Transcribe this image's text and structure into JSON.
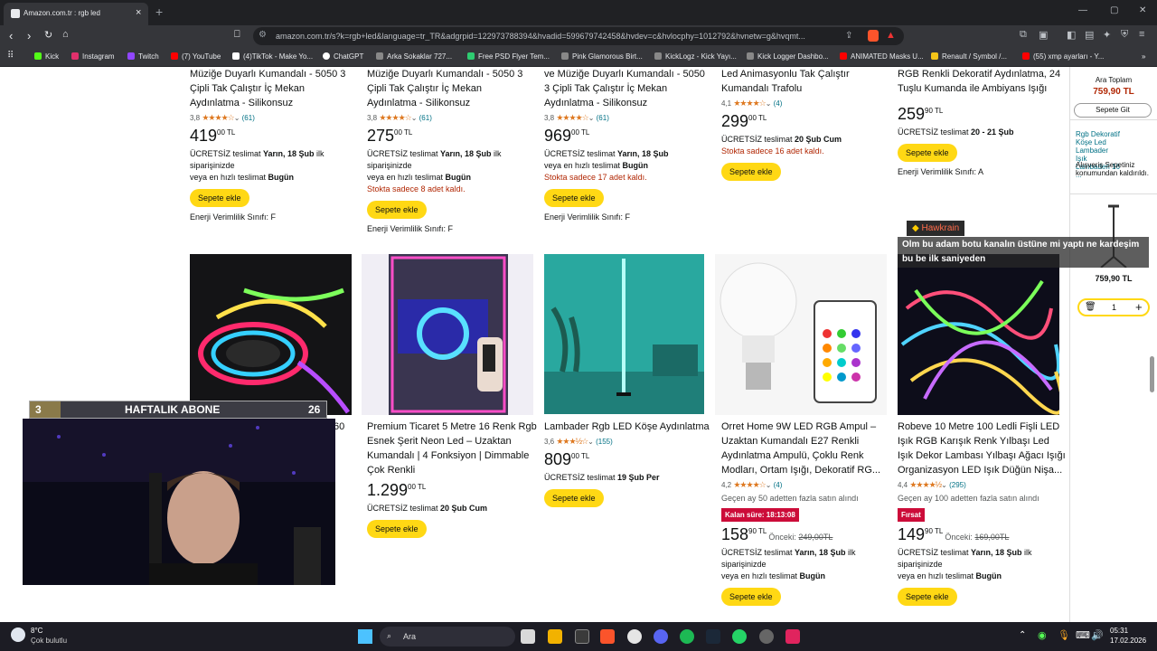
{
  "browser": {
    "tab_title": "Amazon.com.tr : rgb led",
    "new_tab": "+",
    "url": "amazon.com.tr/s?k=rgb+led&language=tr_TR&adgrpid=122973788394&hvadid=599679742458&hvdev=c&hvlocphy=1012792&hvnetw=g&hvqmt...",
    "bookmarks": [
      {
        "label": "Kick",
        "color": "#53fc18"
      },
      {
        "label": "Instagram",
        "color": "#e1306c"
      },
      {
        "label": "Twitch",
        "color": "#9146ff"
      },
      {
        "label": "(7) YouTube",
        "color": "#ff0000"
      },
      {
        "label": "(4)TikTok - Make Yo...",
        "color": "#ffffff"
      },
      {
        "label": "ChatGPT",
        "color": "#ffffff"
      },
      {
        "label": "Arka Sokaklar 727...",
        "color": "#888888"
      },
      {
        "label": "Free PSD Flyer Tem...",
        "color": "#2ecc71"
      },
      {
        "label": "Pink Glamorous Birt...",
        "color": "#888888"
      },
      {
        "label": "KickLogz - Kick Yayı...",
        "color": "#888888"
      },
      {
        "label": "Kick Logger Dashbo...",
        "color": "#888888"
      },
      {
        "label": "ANIMATED Masks U...",
        "color": "#ff0000"
      },
      {
        "label": "Renault / Symbol /...",
        "color": "#f5c518"
      },
      {
        "label": "(55) xmp ayarları - Y...",
        "color": "#ff0000"
      }
    ]
  },
  "top_cards": [
    {
      "title_l1": "Müziğe Duyarlı Kumandalı - 5050 3",
      "title_l2": "Çipli Tak Çalıştır İç Mekan",
      "title_l3": "Aydınlatma - Silikonsuz",
      "rating": "3,8",
      "stars": "★★★★☆",
      "count": "(61)",
      "price_whole": "419",
      "price_frac": "00 TL",
      "deliv_l1": "ÜCRETSİZ teslimat ",
      "deliv_b1": "Yarın, 18 Şub",
      "deliv_l1b": " ilk",
      "deliv_l2": "siparişinizde",
      "deliv_l3": "veya en hızlı teslimat ",
      "deliv_b3": "Bugün",
      "stock": "",
      "button": "Sepete ekle",
      "energy": "Enerji Verimlilik Sınıfı: F"
    },
    {
      "title_l1": "Müziğe Duyarlı Kumandalı - 5050 3",
      "title_l2": "Çipli Tak Çalıştır İç Mekan",
      "title_l3": "Aydınlatma - Silikonsuz",
      "rating": "3,8",
      "stars": "★★★★☆",
      "count": "(61)",
      "price_whole": "275",
      "price_frac": "00 TL",
      "deliv_l1": "ÜCRETSİZ teslimat ",
      "deliv_b1": "Yarın, 18 Şub",
      "deliv_l1b": " ilk",
      "deliv_l2": "siparişinizde",
      "deliv_l3": "veya en hızlı teslimat ",
      "deliv_b3": "Bugün",
      "stock": "Stokta sadece 8 adet kaldı.",
      "button": "Sepete ekle",
      "energy": "Enerji Verimlilik Sınıfı: F"
    },
    {
      "title_l1": "ve Müziğe Duyarlı Kumandalı - 5050",
      "title_l2": "3 Çipli Tak Çalıştır İç Mekan",
      "title_l3": "Aydınlatma - Silikonsuz",
      "rating": "3,8",
      "stars": "★★★★☆",
      "count": "(61)",
      "price_whole": "969",
      "price_frac": "00 TL",
      "deliv_l1": "ÜCRETSİZ teslimat ",
      "deliv_b1": "Yarın, 18 Şub",
      "deliv_l1b": "",
      "deliv_l2": "",
      "deliv_l3": "veya en hızlı teslimat ",
      "deliv_b3": "Bugün",
      "stock": "Stokta sadece 17 adet kaldı.",
      "button": "Sepete ekle",
      "energy": "Enerji Verimlilik Sınıfı: F"
    },
    {
      "title_l1": "Led Animasyonlu Tak Çalıştır",
      "title_l2": "Kumandalı Trafolu",
      "title_l3": "",
      "rating": "4,1",
      "stars": "★★★★☆",
      "count": "(4)",
      "price_whole": "299",
      "price_frac": "00 TL",
      "deliv_l1": "ÜCRETSİZ teslimat ",
      "deliv_b1": "20 Şub Cum",
      "deliv_l1b": "",
      "deliv_l2": "",
      "deliv_l3": "",
      "deliv_b3": "",
      "stock": "Stokta sadece 16 adet kaldı.",
      "button": "Sepete ekle",
      "energy": ""
    },
    {
      "title_l1": "RGB Renkli Dekoratif Aydınlatma, 24",
      "title_l2": "Tuşlu Kumanda ile Ambiyans Işığı",
      "title_l3": "",
      "rating": "",
      "stars": "",
      "count": "",
      "price_whole": "259",
      "price_frac": "90 TL",
      "deliv_l1": "ÜCRETSİZ teslimat ",
      "deliv_b1": "20 - 21 Şub",
      "deliv_l1b": "",
      "deliv_l2": "",
      "deliv_l3": "",
      "deliv_b3": "",
      "stock": "",
      "button": "Sepete ekle",
      "energy": "Enerji Verimlilik Sınıfı: A"
    }
  ],
  "bottom_cards": [
    {
      "title": "Premium Ticaret 5 Metre 16 Renk Rgb Esnek Şerit Neon Led – Uzaktan Kumandalı | 4 Fonksiyon | Dimmable Çok Renkli",
      "rating": "",
      "stars": "",
      "count": "",
      "price_whole": "1.299",
      "price_frac": "00 TL",
      "deliv": "ÜCRETSİZ teslimat ",
      "deliv_b": "20 Şub Cum",
      "button": "Sepete ekle"
    },
    {
      "title": "Lambader Rgb LED Köşe Aydınlatma",
      "rating": "3,6",
      "stars": "★★★½☆",
      "count": "(155)",
      "price_whole": "809",
      "price_frac": "00 TL",
      "deliv": "ÜCRETSİZ teslimat ",
      "deliv_b": "19 Şub Per",
      "button": "Sepete ekle"
    },
    {
      "title": "Orret Home 9W LED RGB Ampul – Uzaktan Kumandalı E27 Renkli Aydınlatma Ampulü, Çoklu Renk Modları, Ortam Işığı, Dekoratif RG...",
      "rating": "4,2",
      "stars": "★★★★☆",
      "count": "(4)",
      "bought": "Geçen ay 50 adetten fazla satın alındı",
      "deal": "Kalan süre: 18:13:08",
      "price_whole": "158",
      "price_frac": "90 TL",
      "old_label": "Önceki: ",
      "old_price": "249,00TL",
      "deliv": "ÜCRETSİZ teslimat ",
      "deliv_b": "Yarın, 18 Şub",
      "deliv_tail": " ilk",
      "deliv_l2": "siparişinizde",
      "deliv_l3": "veya en hızlı teslimat ",
      "deliv_b3": "Bugün",
      "button": "Sepete ekle"
    },
    {
      "title": "Robeve 10 Metre 100 Ledli Fişli LED Işık RGB Karışık Renk Yılbaşı Led Işık Dekor Lambası Yılbaşı Ağacı Işığı Organizasyon LED Işık Düğün Nişa...",
      "rating": "4,4",
      "stars": "★★★★½",
      "count": "(295)",
      "bought": "Geçen ay 100 adetten fazla satın alındı",
      "deal": "Fırsat",
      "price_whole": "149",
      "price_frac": "90 TL",
      "old_label": "Önceki: ",
      "old_price": "169,00TL",
      "deliv": "ÜCRETSİZ teslimat ",
      "deliv_b": "Yarın, 18 Şub",
      "deliv_tail": " ilk",
      "deliv_l2": "siparişinizde",
      "deliv_l3": "veya en hızlı teslimat ",
      "deliv_b3": "Bugün",
      "button": "Sepete ekle"
    }
  ],
  "hidden_card_price_fragment": "60",
  "side": {
    "total_label": "Ara Toplam",
    "total": "759,90 TL",
    "go_cart": "Sepete Git",
    "item_link": "Rgb Dekoratif Köşe Led Lambader Işık Lambaderi 16 ...",
    "address_note": "Alışveriş Sepetiniz konumundan kaldırıldı.",
    "item_price": "759,90 TL",
    "qty": "1"
  },
  "overlay": {
    "sub_left": "3",
    "sub_title": "HAFTALIK ABONE",
    "sub_right": "26",
    "chat_user": "Hawkrain",
    "chat_msg": "Olm bu adam botu kanalın üstüne mi yaptı ne kardeşim bu be ilk saniyeden"
  },
  "taskbar": {
    "weather_temp": "8°C",
    "weather_desc": "Çok bulutlu",
    "search": "Ara",
    "time": "05:31",
    "date": "17.02.2026"
  }
}
